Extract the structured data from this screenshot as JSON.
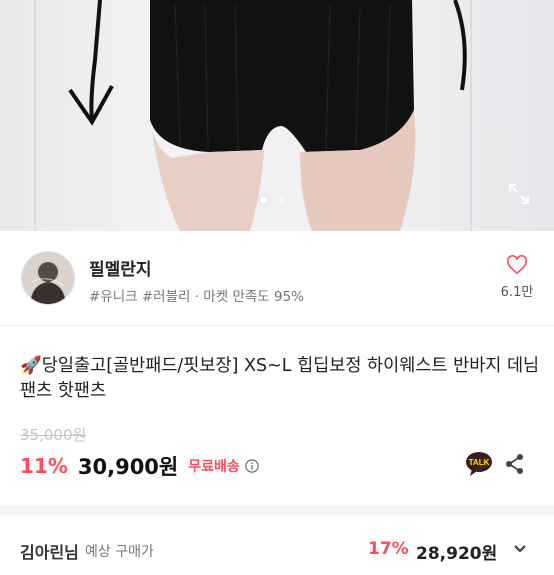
{
  "shop": {
    "name": "필멜란지",
    "tags": "#유니크 #러블리 · 마켓 만족도 95%",
    "like_count": "6.1만"
  },
  "product": {
    "title": "🚀당일출고[골반패드/핏보장] XS~L 힙딥보정 하이웨스트 반바지 데님팬츠 핫팬츠",
    "original_price": "35,000원",
    "discount": "11%",
    "price": "30,900원",
    "shipping": "무료배송"
  },
  "coupon": {
    "name": "김아린님",
    "label": "예상 구매가",
    "discount": "17%",
    "price": "28,920원"
  },
  "carousel": {
    "count": 2,
    "active": 0
  },
  "colors": {
    "accent": "#ff4d5a",
    "talk": "#3c1e1e",
    "kakao_yellow": "#fee500"
  },
  "icons": [
    "expand-icon",
    "heart-icon",
    "kakao-talk-icon",
    "share-icon",
    "info-icon",
    "chevron-down-icon"
  ]
}
